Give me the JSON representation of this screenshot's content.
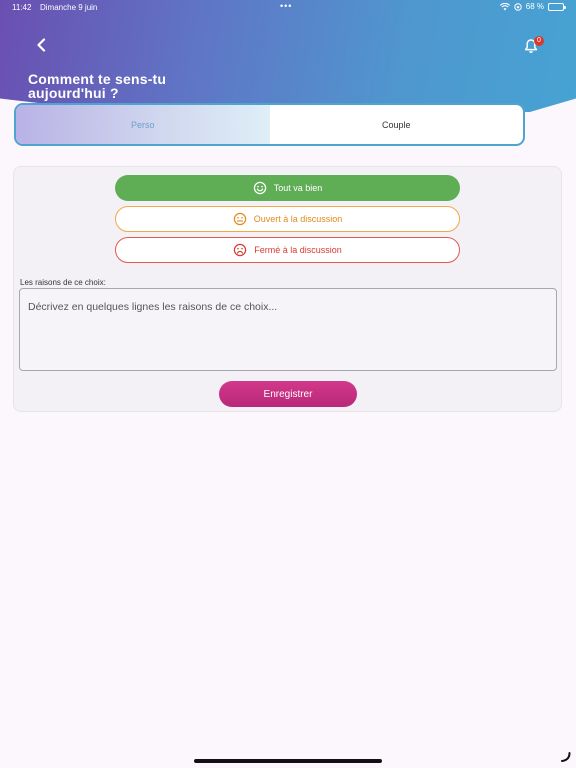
{
  "status_bar": {
    "time": "11:42",
    "date": "Dimanche 9 juin",
    "dots": "•••",
    "battery": "68 %"
  },
  "header": {
    "title_line1": "Comment te sens-tu",
    "title_line2": "aujourd'hui ?",
    "back_icon": "chevron-left-icon",
    "notification_icon": "bell-icon",
    "notification_count": "0"
  },
  "tabs": [
    {
      "label": "Perso",
      "active": true
    },
    {
      "label": "Couple",
      "active": false
    }
  ],
  "moods": {
    "good": {
      "label": "Tout va bien",
      "icon": "smile-icon",
      "color": "#5fad55"
    },
    "open": {
      "label": "Ouvert à la discussion",
      "icon": "neutral-face-icon",
      "color": "#f2a847"
    },
    "closed": {
      "label": "Fermé à la discussion",
      "icon": "sad-face-icon",
      "color": "#d83a32"
    }
  },
  "reasons": {
    "label": "Les raisons de ce choix:",
    "placeholder": "Décrivez en quelques lignes les raisons de ce choix..."
  },
  "save_label": "Enregistrer",
  "colors": {
    "accent_pink": "#c42e82",
    "header_gradient_start": "#6a4fb1",
    "header_gradient_end": "#46a3d3"
  }
}
